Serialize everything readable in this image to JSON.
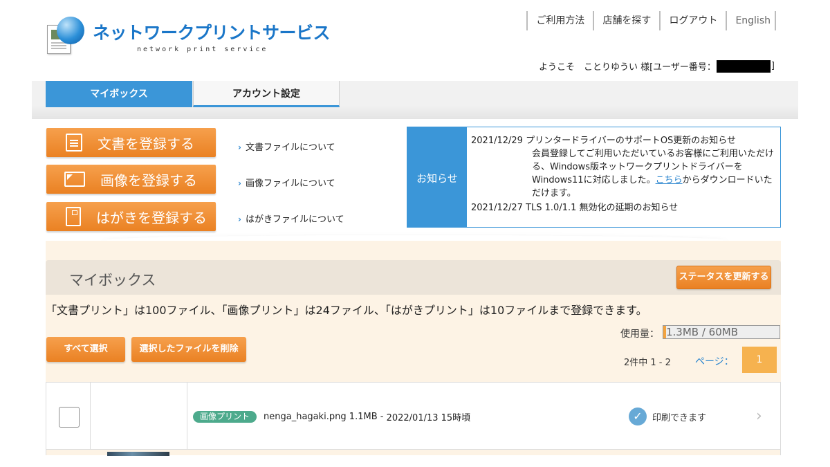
{
  "header": {
    "logo_title": "ネットワークプリントサービス",
    "logo_subtitle": "network print service",
    "nav": [
      "ご利用方法",
      "店舗を探す",
      "ログアウト",
      "English"
    ],
    "welcome_prefix": "ようこそ　ことりゆうい 様[ユーザー番号：",
    "welcome_suffix": "]"
  },
  "tabs": [
    {
      "label": "マイボックス",
      "active": true
    },
    {
      "label": "アカウント設定",
      "active": false
    }
  ],
  "register": {
    "doc_label": "文書を登録する",
    "image_label": "画像を登録する",
    "card_label": "はがきを登録する",
    "doc_about": "文書ファイルについて",
    "image_about": "画像ファイルについて",
    "card_about": "はがきファイルについて"
  },
  "news": {
    "label": "お知らせ",
    "items": [
      {
        "date": "2021/12/29",
        "title": "プリンタードライバーのサポートOS更新のお知らせ",
        "body_before_link": "会員登録してご利用いただいているお客様にご利用いただける、Windows版ネットワークプリントドライバーをWindows11に対応しました。",
        "link": "こちら",
        "body_after_link": "からダウンロードいただけます。"
      },
      {
        "date": "2021/12/27",
        "title": "TLS 1.0/1.1 無効化の延期のお知らせ"
      }
    ]
  },
  "mybox": {
    "title": "マイボックス",
    "refresh_label": "ステータスを更新する",
    "limit_text": "「文書プリント」は100ファイル、「画像プリント」は24ファイル、「はがきプリント」は10ファイルまで登録できます。",
    "usage_label": "使用量：",
    "usage_text": "1.3MB / 60MB",
    "usage_fraction": 0.022,
    "select_all_label": "すべて選択",
    "delete_label": "選択したファイルを削除",
    "count_text": "2件中 1 - 2",
    "page_label": "ページ：",
    "current_page": "1"
  },
  "files": [
    {
      "badge": "画像プリント",
      "name": "nenga_hagaki.png",
      "size": "1.1MB",
      "registered": "2022/01/13 15時頃",
      "status": "印刷できます"
    }
  ],
  "colors": {
    "brand_blue": "#3b96d8",
    "orange": "#ea8123",
    "badge_green": "#4daa8c",
    "panel_bg": "#fdf3e5"
  }
}
